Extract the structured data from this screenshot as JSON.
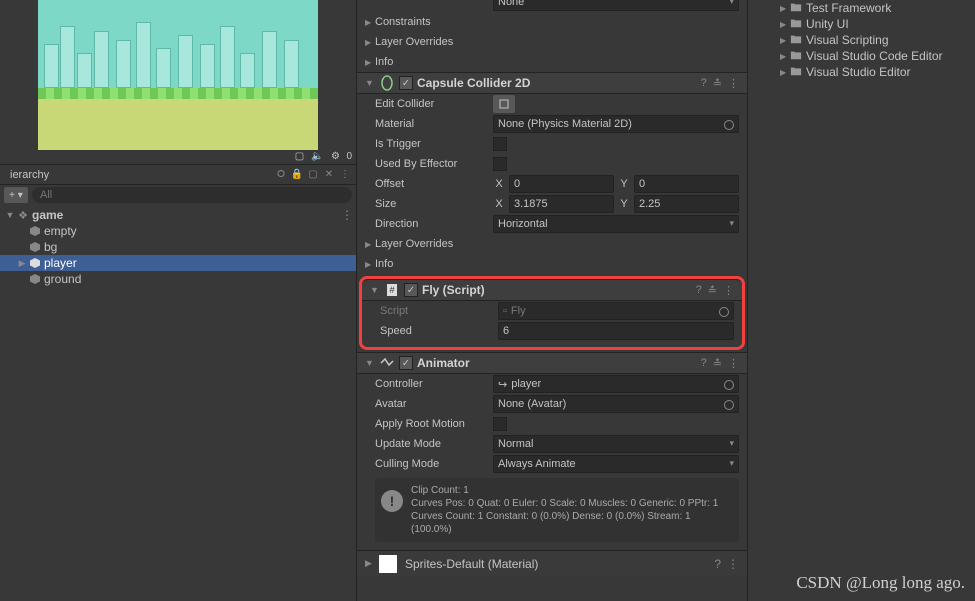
{
  "hierarchy": {
    "tab": "ierarchy",
    "search_placeholder": "All",
    "scene": "game",
    "items": [
      "empty",
      "bg",
      "player",
      "ground"
    ],
    "selected": "player",
    "footer_count": "0"
  },
  "inspector": {
    "top_rows": {
      "constraints": "Constraints",
      "layer_overrides": "Layer Overrides",
      "info": "Info"
    },
    "capsule": {
      "title": "Capsule Collider 2D",
      "edit_collider": "Edit Collider",
      "material_lbl": "Material",
      "material_val": "None (Physics Material 2D)",
      "is_trigger": "Is Trigger",
      "used_by_effector": "Used By Effector",
      "offset": "Offset",
      "offset_x": "0",
      "offset_y": "0",
      "size": "Size",
      "size_x": "3.1875",
      "size_y": "2.25",
      "direction": "Direction",
      "direction_val": "Horizontal",
      "layer_overrides": "Layer Overrides",
      "info": "Info"
    },
    "fly": {
      "title": "Fly (Script)",
      "script_lbl": "Script",
      "script_val": "Fly",
      "speed_lbl": "Speed",
      "speed_val": "6"
    },
    "animator": {
      "title": "Animator",
      "controller_lbl": "Controller",
      "controller_val": "player",
      "avatar_lbl": "Avatar",
      "avatar_val": "None (Avatar)",
      "apply_root": "Apply Root Motion",
      "update_mode": "Update Mode",
      "update_mode_val": "Normal",
      "culling_mode": "Culling Mode",
      "culling_mode_val": "Always Animate",
      "info_text": "Clip Count: 1\nCurves Pos: 0 Quat: 0 Euler: 0 Scale: 0 Muscles: 0 Generic: 0 PPtr: 1\nCurves Count: 1 Constant: 0 (0.0%) Dense: 0 (0.0%) Stream: 1 (100.0%)"
    },
    "material": "Sprites-Default (Material)",
    "interpolate_val": "None"
  },
  "project": {
    "items": [
      {
        "label": "Test Framework",
        "indent": 1,
        "fold": true
      },
      {
        "label": "Unity UI",
        "indent": 1,
        "fold": true
      },
      {
        "label": "Visual Scripting",
        "indent": 1,
        "fold": true
      },
      {
        "label": "Visual Studio Code Editor",
        "indent": 1,
        "fold": true
      },
      {
        "label": "Visual Studio Editor",
        "indent": 1,
        "fold": true
      }
    ]
  },
  "watermark": "CSDN @Long long ago."
}
